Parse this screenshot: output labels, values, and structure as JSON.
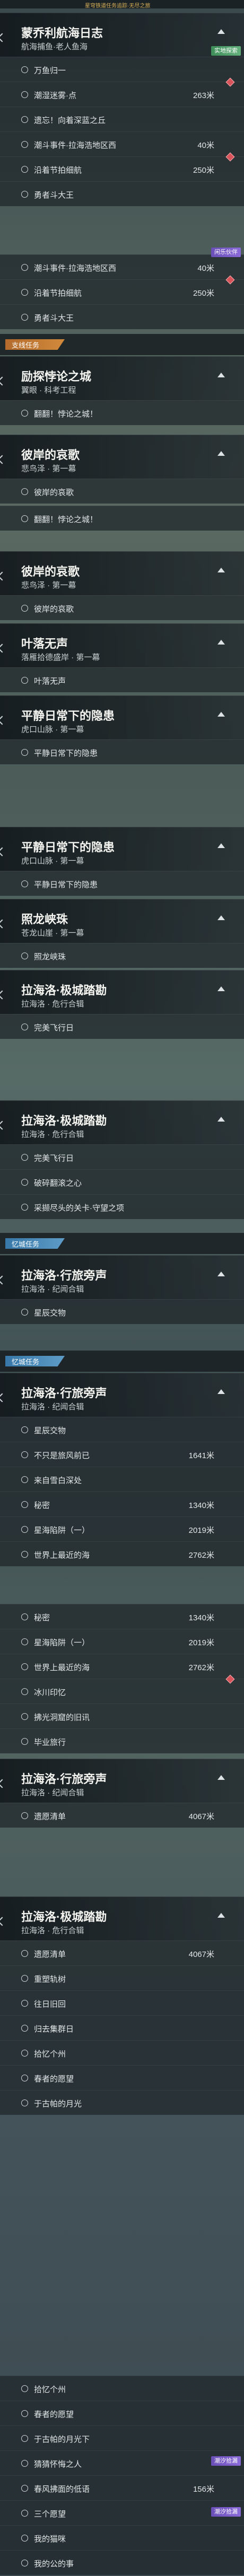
{
  "top_bar": {
    "text": "星穹铁道任务追踪·无尽之旅"
  },
  "sections": {
    "side_quest": "支线任务",
    "memory_quest": "忆城任务"
  },
  "quests": {
    "q1": {
      "title": "蒙乔利航海日志",
      "subtitle": "航海捕鱼·老人鱼海",
      "badge": "实地探索",
      "rows": [
        "万鱼归一",
        "潮湿迷雾·点",
        "遗忘！向着深蓝之丘",
        "潮斗事件·拉海浩地区西",
        "沿着节拍细航",
        "勇者斗大王"
      ],
      "dists": {
        "r2": "263米",
        "r4": "40米",
        "r5": "250米"
      }
    },
    "q1b": {
      "rows": [
        "潮斗事件·拉海浩地区西",
        "沿着节拍细航",
        "勇者斗大王"
      ],
      "dists": {
        "r1": "40米",
        "r2": "250米"
      },
      "badge": "闲乐伙伴"
    },
    "q2": {
      "title": "励探悖论之城",
      "subtitle": "翼眼 · 科考工程",
      "rows": [
        "翻翻！悖论之城！"
      ]
    },
    "q3": {
      "title": "彼岸的哀歌",
      "subtitle": "悲鸟泽 · 第一幕",
      "rows": [
        "彼岸的哀歌",
        "翻翻！悖论之城！"
      ]
    },
    "q4": {
      "title": "彼岸的哀歌",
      "subtitle": "悲鸟泽 · 第一幕",
      "rows": [
        "彼岸的哀歌"
      ]
    },
    "q5": {
      "title": "叶落无声",
      "subtitle": "落雁拾德盛岸 · 第一幕",
      "rows": [
        "叶落无声"
      ]
    },
    "q6": {
      "title": "平静日常下的隐患",
      "subtitle": "虎口山脉 · 第一幕",
      "rows": [
        "平静日常下的隐患"
      ]
    },
    "q7": {
      "title": "平静日常下的隐患",
      "subtitle": "虎口山脉 · 第一幕",
      "rows": [
        "平静日常下的隐患"
      ]
    },
    "q8": {
      "title": "照龙峡珠",
      "subtitle": "苍龙山崖 · 第一幕",
      "rows": [
        "照龙峡珠"
      ]
    },
    "q9": {
      "title": "拉海洛·极城踏勘",
      "subtitle": "拉海洛 · 危行合辑",
      "rows": [
        "完美飞行日"
      ]
    },
    "q10": {
      "title": "拉海洛·极城踏勘",
      "subtitle": "拉海洛 · 危行合辑",
      "rows": [
        "完美飞行日",
        "破碎翻滚之心",
        "采撷尽头的关卡·守望之项"
      ]
    },
    "q11": {
      "title": "拉海洛·行旅旁声",
      "subtitle": "拉海洛 · 纪闻合辑",
      "rows": [
        "星辰交物"
      ]
    },
    "q12": {
      "title": "拉海洛·行旅旁声",
      "subtitle": "拉海洛 · 纪闻合辑",
      "rows": [
        "星辰交物",
        "不只是旅风前已",
        "来自雪白深处",
        "秘密",
        "星海陷阱（一）",
        "世界上最近的海"
      ],
      "dists": {
        "r2": "1641米",
        "r4": "1340米",
        "r5": "2019米",
        "r6": "2762米"
      }
    },
    "q13": {
      "rows": [
        "秘密",
        "星海陷阱（一）",
        "世界上最近的海",
        "冰川印忆",
        "拂光洞窟的旧讯",
        "毕业旅行"
      ],
      "dists": {
        "r1": "1340米",
        "r2": "2019米",
        "r3": "2762米"
      }
    },
    "q14": {
      "title": "拉海洛·行旅旁声",
      "subtitle": "拉海洛 · 纪闻合辑",
      "rows": [
        "遗愿清单"
      ],
      "dists": {
        "r1": "4067米"
      }
    },
    "q15": {
      "title": "拉海洛·极城踏勘",
      "subtitle": "拉海洛 · 危行合辑",
      "rows": [
        "遗愿清单",
        "重塑轨树",
        "往日旧回",
        "归去集群日",
        "拾忆个州",
        "春者的愿望",
        "于古帕的月光"
      ],
      "dists": {
        "r1": "4067米"
      }
    },
    "q16": {
      "rows": [
        "拾忆个州",
        "春者的愿望",
        "于古帕的月光下",
        "猜猜怀悔之人",
        "春风拂面的低语",
        "三个愿望",
        "我的猫咪",
        "我的公的事"
      ],
      "dists": {
        "r5": "156米"
      },
      "badges": [
        "潮汐拾漏",
        "潮汐拾漏"
      ]
    }
  }
}
